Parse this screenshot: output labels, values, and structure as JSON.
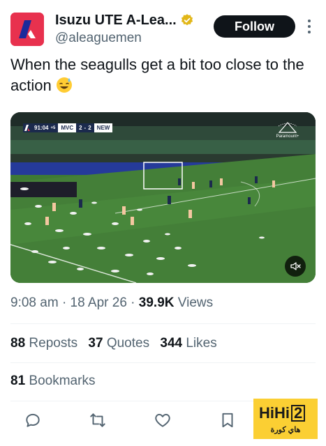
{
  "account": {
    "display_name": "Isuzu UTE A-Lea...",
    "handle": "@aleaguemen",
    "follow_label": "Follow"
  },
  "tweet": {
    "text": "When the seagulls get a bit too close to the action",
    "emoji": "sweat-smile-emoji"
  },
  "video": {
    "scorebug": {
      "clock": "91:04",
      "added_time": "+5",
      "home": "MVC",
      "home_score": "2",
      "away_score": "2",
      "away": "NEW"
    },
    "broadcaster": "Paramount+",
    "mute_icon": "muted-speaker-icon"
  },
  "meta": {
    "time": "9:08 am",
    "date": "18 Apr 26",
    "views_count": "39.9K",
    "views_label": "Views"
  },
  "stats": {
    "reposts_count": "88",
    "reposts_label": "Reposts",
    "quotes_count": "37",
    "quotes_label": "Quotes",
    "likes_count": "344",
    "likes_label": "Likes",
    "bookmarks_count": "81",
    "bookmarks_label": "Bookmarks"
  },
  "actions": [
    "reply-icon",
    "repost-icon",
    "like-icon",
    "bookmark-icon"
  ],
  "watermark": {
    "text": "HiHi",
    "number": "2",
    "arabic": "هاي كورة"
  },
  "colors": {
    "brand_avatar": "#e8314e",
    "verified_gold": "#e2b719",
    "follow_bg": "#0f1419",
    "muted_text": "#536471",
    "watermark_bg": "#fbcf33"
  }
}
